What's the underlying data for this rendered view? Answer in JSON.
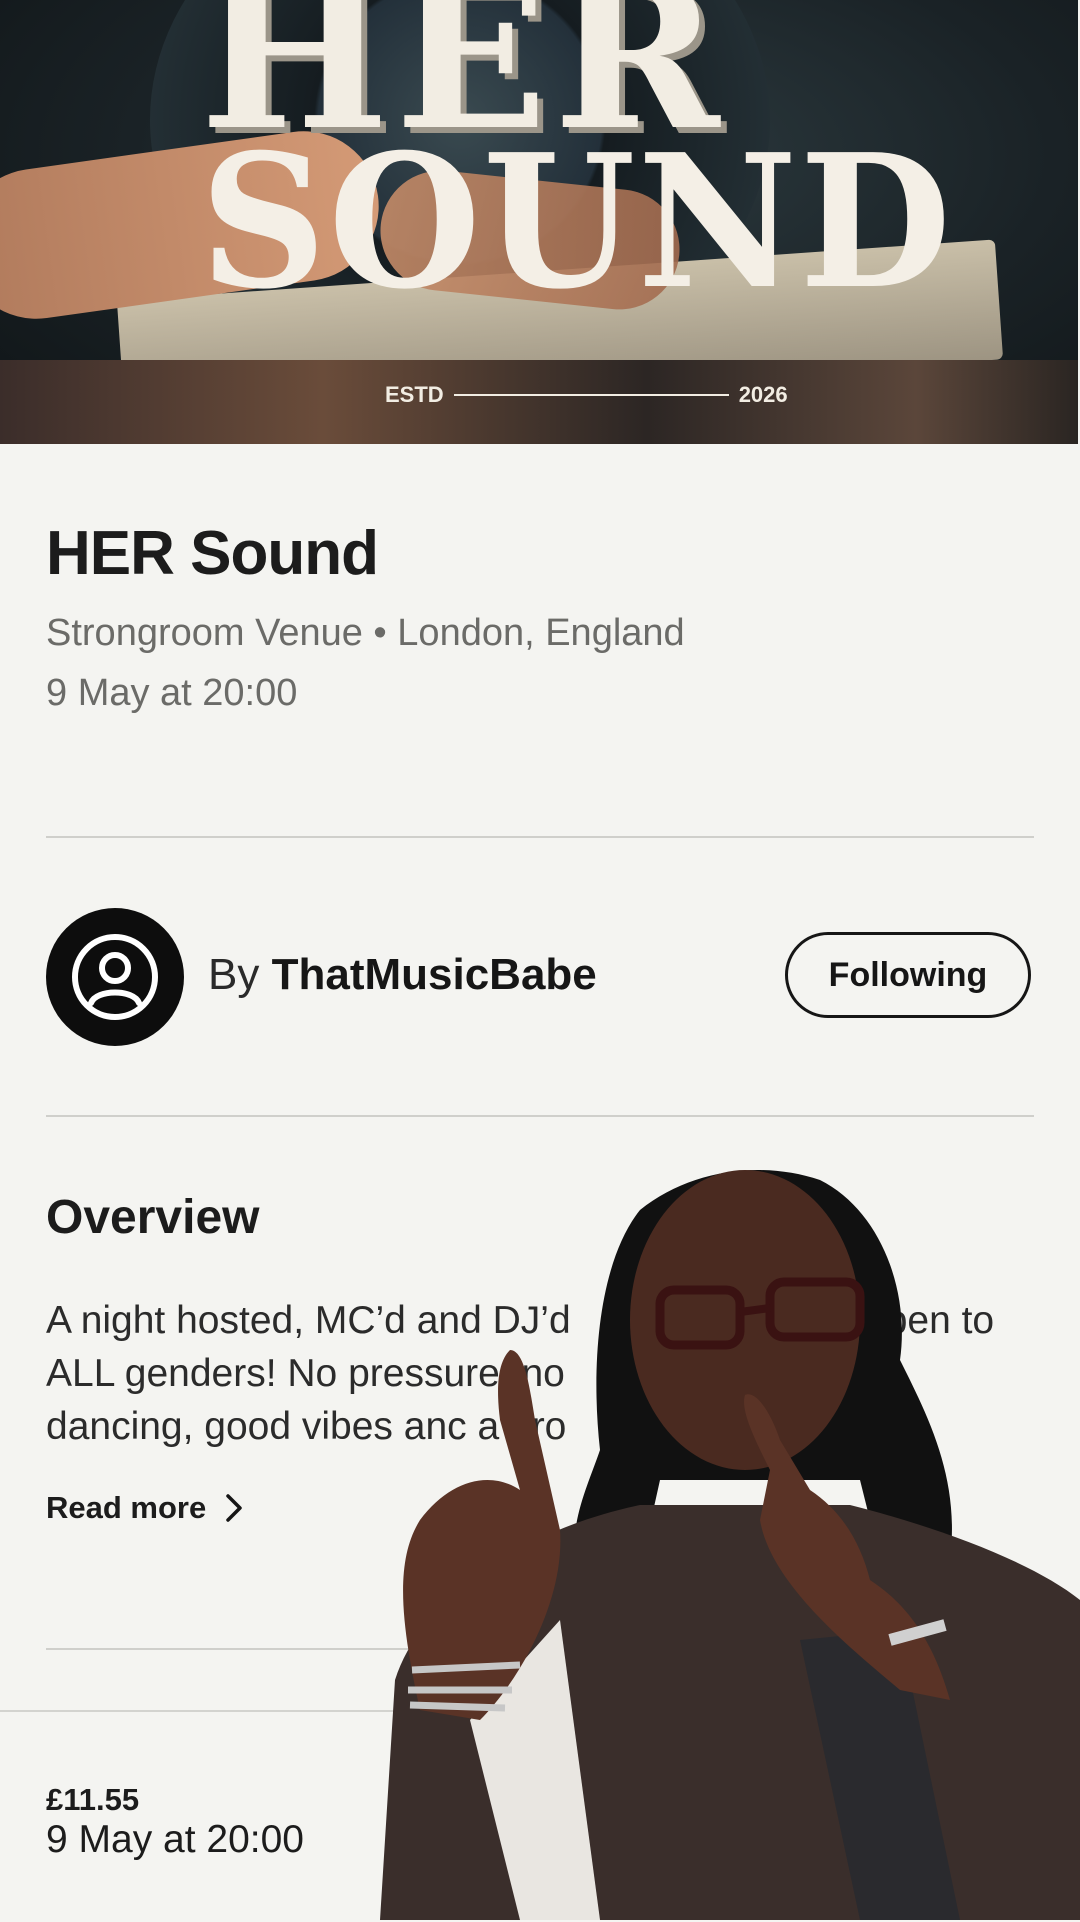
{
  "hero": {
    "poster_title_line1": "HER",
    "poster_title_line2": "SOUND",
    "estd_label": "ESTD",
    "estd_year": "2026"
  },
  "event": {
    "title": "HER Sound",
    "venue": "Strongroom Venue • London, England",
    "date": "9 May at 20:00"
  },
  "organizer": {
    "by_label": "By",
    "name": "ThatMusicBabe",
    "follow_label": "Following"
  },
  "overview": {
    "heading": "Overview",
    "description_line1": "A night hosted, MC’d and DJ’d",
    "description_line1_end": "open to",
    "description_line2": "ALL genders! No pressu",
    "description_line2_end": "re, no",
    "description_line3": "dancing, good vibes anc",
    "description_line3_end": "a pro",
    "read_more_label": "Read more"
  },
  "footer": {
    "price": "£11.55",
    "date": "9 May at 20:00"
  },
  "colors": {
    "background": "#f4f4f1",
    "text_primary": "#1c1c1c",
    "text_secondary": "#6b6b68",
    "divider": "#cfcfcb"
  }
}
